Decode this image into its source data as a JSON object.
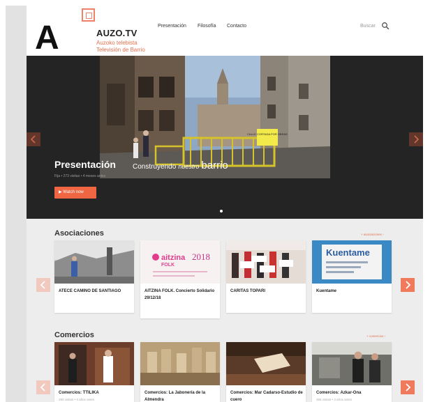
{
  "brand": {
    "letter": "A",
    "title": "AUZO.TV",
    "subtitle1": "Auzoko telebista",
    "subtitle2": "Televisión de Barrio"
  },
  "nav": {
    "items": [
      {
        "label": "Presentación"
      },
      {
        "label": "Filosofía"
      },
      {
        "label": "Contacto"
      }
    ]
  },
  "search": {
    "label": "Buscar"
  },
  "hero": {
    "title": "Presentación",
    "caption_a": "Construyendo",
    "caption_b": "nuestro",
    "caption_c": "barrio",
    "meta": "Fija  •  273 visitas  •  4 meses antes",
    "watch_label": "▶ Watch now",
    "sign_text": "CALLE CORTADA POR OBRAS"
  },
  "asociaciones": {
    "title": "Asociaciones",
    "more_link": "+ asociaciones ›",
    "cards": [
      {
        "title": "ATECE CAMINO DE SANTIAGO"
      },
      {
        "title": "AITZINA FOLK. Concierto Solidario 29/12/18",
        "poster_brand": "aitzina",
        "poster_brand2": "FOLK",
        "poster_year": "2018"
      },
      {
        "title": "CARITAS TOPARI"
      },
      {
        "title": "Kuentame",
        "sign_text": "Kuentame"
      }
    ]
  },
  "comercios": {
    "title": "Comercios",
    "more_link": "+ comercios ›",
    "cards": [
      {
        "title": "Comercios: TTILIKA",
        "meta": "293 visitas  •  4 años antes"
      },
      {
        "title": "Comercios: La Jabonería de la Almendra",
        "meta": ""
      },
      {
        "title": "Comercios: Mar Cadarso-Estudio de cuero",
        "meta": ""
      },
      {
        "title": "Comercios: Azkar-Ona",
        "meta": "366 visitas  •  4 años antes"
      }
    ]
  },
  "colors": {
    "accent": "#f06643",
    "hero_bg": "#242424",
    "page_bg": "#ededed"
  }
}
